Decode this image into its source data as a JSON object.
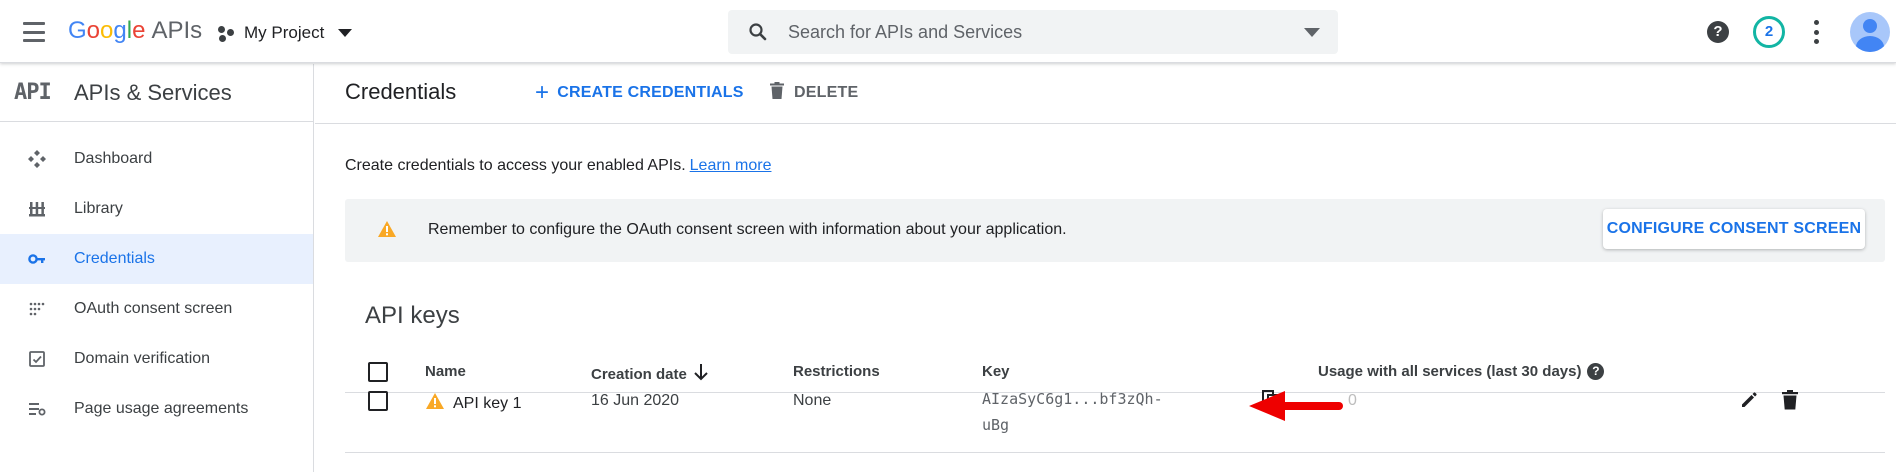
{
  "header": {
    "logo": {
      "letters": [
        "G",
        "o",
        "o",
        "g",
        "l",
        "e"
      ],
      "suffix": "APIs"
    },
    "project_name": "My Project",
    "search_placeholder": "Search for APIs and Services",
    "notification_count": "2",
    "help_glyph": "?"
  },
  "sidebar": {
    "api_mark": "API",
    "title": "APIs & Services",
    "items": [
      {
        "label": "Dashboard",
        "icon": "dashboard-icon",
        "active": false
      },
      {
        "label": "Library",
        "icon": "library-icon",
        "active": false
      },
      {
        "label": "Credentials",
        "icon": "key-icon",
        "active": true
      },
      {
        "label": "OAuth consent screen",
        "icon": "oauth-consent-icon",
        "active": false
      },
      {
        "label": "Domain verification",
        "icon": "domain-verification-icon",
        "active": false
      },
      {
        "label": "Page usage agreements",
        "icon": "page-usage-icon",
        "active": false
      }
    ]
  },
  "main": {
    "title": "Credentials",
    "create_label": "CREATE CREDENTIALS",
    "delete_label": "DELETE",
    "intro_text": "Create credentials to access your enabled APIs.",
    "learn_more": "Learn more",
    "banner_text": "Remember to configure the OAuth consent screen with information about your application.",
    "consent_button": "CONFIGURE CONSENT SCREEN",
    "section_title": "API keys",
    "table": {
      "columns": {
        "name": "Name",
        "creation_date": "Creation date",
        "restrictions": "Restrictions",
        "key": "Key",
        "usage": "Usage with all services (last 30 days)"
      },
      "rows": [
        {
          "name": "API key 1",
          "creation_date": "16 Jun 2020",
          "restrictions": "None",
          "key_line1": "AIzaSyC6g1...bf3zQh-",
          "key_line2": "uBg",
          "usage": "0"
        }
      ]
    }
  },
  "colors": {
    "accent": "#1a73e8",
    "warning": "#f9a825",
    "annotation_arrow": "#ee0000",
    "active_bg": "#e8f0fe"
  }
}
